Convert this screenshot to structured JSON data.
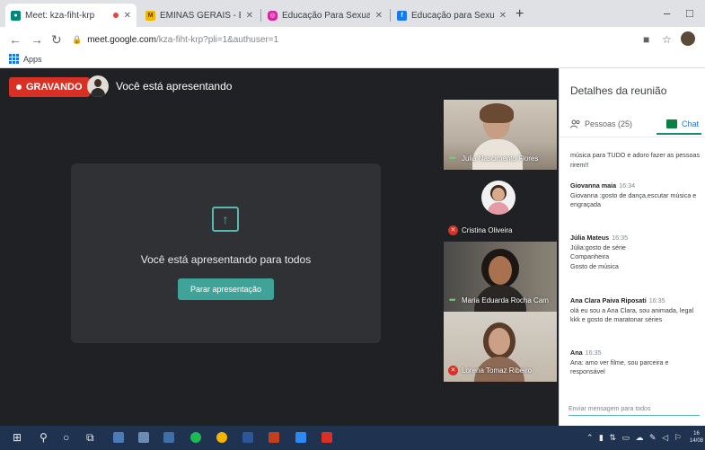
{
  "browser": {
    "tabs": [
      {
        "label": "Meet: kza-fiht-krp",
        "recording": true
      },
      {
        "label": "EMINAS GERAIS - E.M. - SAÚD"
      },
      {
        "label": "Educação Para Sexualidade UFTI"
      },
      {
        "label": "Educação para Sexualidade - UF"
      }
    ],
    "address": {
      "host": "meet.google.com",
      "path": "/kza-fiht-krp?pli=1&authuser=1"
    },
    "bookmarks_label": "Apps"
  },
  "meet": {
    "recording_label": "GRAVANDO",
    "presenting_title": "Você está apresentando",
    "present_message": "Você está apresentando para todos",
    "stop_button": "Parar apresentação",
    "participants": [
      {
        "name": "Julia Nascimento Flores",
        "muted": false
      },
      {
        "name": "Cristina Oliveira",
        "muted": true
      },
      {
        "name": "Maria Eduarda Rocha Cam",
        "muted": false
      },
      {
        "name": "Lorena Tomaz Ribeiro",
        "muted": true
      }
    ]
  },
  "panel": {
    "title": "Detalhes da reunião",
    "people_tab": "Pessoas (25)",
    "chat_tab": "Chat",
    "cut_message": {
      "text1": "música para TUDO e adoro fazer as pessoas",
      "text2": "rirem!!"
    },
    "messages": [
      {
        "sender": "Giovanna maia",
        "time": "16:34",
        "lines": [
          "Giovanna :gosto de dança,escutar música e",
          "engraçada"
        ]
      },
      {
        "sender": "Júlia Mateus",
        "time": "16:35",
        "lines": [
          "Júlia:gosto de série",
          "Companheira",
          "Gosto de música"
        ]
      },
      {
        "sender": "Ana Clara Paiva Riposati",
        "time": "16:35",
        "lines": [
          "olá eu sou a Ana Clara, sou animada, legal",
          "kkk e gosto de maratonar séries"
        ]
      },
      {
        "sender": "Ana",
        "time": "16:35",
        "lines": [
          "Ana: amo ver filme, sou parceira e",
          "responsável"
        ]
      }
    ],
    "composer_placeholder": "Enviar mensagem para todos"
  },
  "taskbar": {
    "clock_time": "16",
    "clock_date": "14/08"
  },
  "colors": {
    "accent": "#3fa39a",
    "recording": "#d93025",
    "chat": "#0b8043"
  }
}
